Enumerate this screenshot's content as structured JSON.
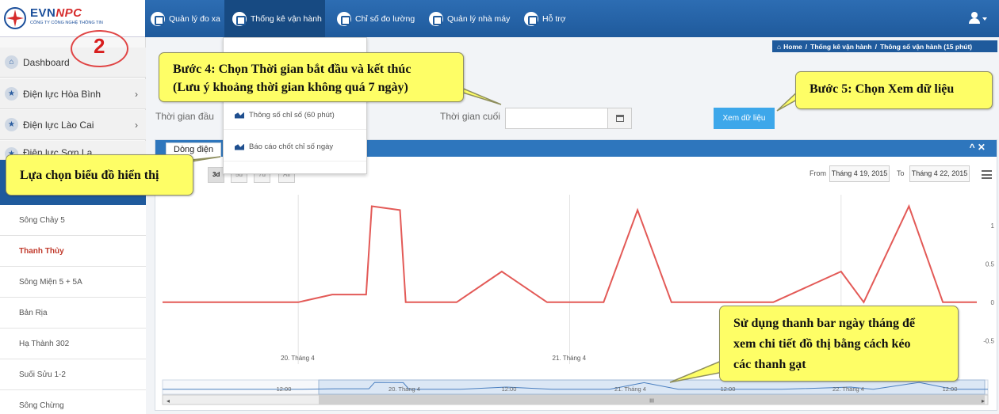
{
  "header": {
    "logo_name_a": "EVN",
    "logo_name_b": "NPC",
    "logo_subtitle": "CÔNG TY CÔNG NGHỆ THÔNG TIN",
    "nav": [
      {
        "label": "Quản lý đo xa",
        "icon": "wifi-icon"
      },
      {
        "label": "Thống kê vận hành",
        "icon": "chart-icon",
        "active": true
      },
      {
        "label": "Chỉ số đo lường",
        "icon": "edit-icon"
      },
      {
        "label": "Quản lý nhà máy",
        "icon": "folder-icon"
      },
      {
        "label": "Hỗ trợ",
        "icon": "folder-icon"
      }
    ],
    "user_icon": "user-icon"
  },
  "sidebar": {
    "main_items": [
      {
        "label": "Dashboard",
        "icon": "home-icon"
      },
      {
        "label": "Điện lực Hòa Bình",
        "icon": "star-icon"
      },
      {
        "label": "Điện lực Lào Cai",
        "icon": "star-icon"
      },
      {
        "label": "Điện lực Sơn La",
        "icon": "star-icon"
      }
    ],
    "sub_items": [
      {
        "label": "Sông Chảy 5"
      },
      {
        "label": "Thanh Thủy",
        "active": true
      },
      {
        "label": "Sông Miện 5 + 5A"
      },
      {
        "label": "Bản Rịa"
      },
      {
        "label": "Hạ Thành 302"
      },
      {
        "label": "Suối Sửu 1-2"
      },
      {
        "label": "Sông Chừng"
      }
    ]
  },
  "breadcrumb": {
    "home": "Home",
    "sep": "/",
    "items": [
      "Thống kê vận hành",
      "Thông số vận hành (15 phút)"
    ]
  },
  "dropdown": {
    "items": [
      "Thông số chỉ số (60 phút)",
      "Báo cáo chốt chỉ số ngày"
    ]
  },
  "filters": {
    "start_label": "Thời gian đầu",
    "end_label": "Thời gian cuối",
    "end_value": "",
    "view_button": "Xem dữ liệu"
  },
  "panel": {
    "tab": "Dòng điện",
    "controls": "^ ✕",
    "range_buttons": [
      "3d",
      "5d",
      "7d",
      "All"
    ],
    "active_range": "3d",
    "from_label": "From",
    "from_value": "Tháng 4 19, 2015",
    "to_label": "To",
    "to_value": "Tháng 4 22, 2015"
  },
  "chart_data": {
    "type": "line",
    "series": [
      {
        "color": "#e35a57",
        "x": [
          "19/4 12:00",
          "19/4 18:00",
          "20/4 00:00",
          "20/4 03:00",
          "20/4 06:00",
          "20/4 06:30",
          "20/4 09:00",
          "20/4 09:30",
          "20/4 14:00",
          "20/4 18:00",
          "20/4 22:00",
          "21/4 03:00",
          "21/4 06:00",
          "21/4 09:00",
          "21/4 12:00",
          "21/4 18:00",
          "22/4 00:00",
          "22/4 02:00",
          "22/4 06:00",
          "22/4 09:00",
          "22/4 12:00"
        ],
        "y": [
          0,
          0,
          0,
          0.1,
          0.1,
          1.25,
          1.2,
          0,
          0,
          0.4,
          0,
          0,
          1.2,
          0,
          0,
          0,
          0.4,
          0,
          1.25,
          0,
          0
        ]
      }
    ],
    "y_ticks": [
      "1",
      "0.5",
      "0",
      "-0.5"
    ],
    "ylim": [
      -0.6,
      1.4
    ],
    "x_tick_labels": [
      "20. Tháng 4",
      "21. Tháng 4"
    ],
    "navigator_labels": [
      "12:00",
      "20. Tháng 4",
      "12:00",
      "21. Tháng 4",
      "12:00",
      "22. Tháng 4",
      "12:00"
    ],
    "navigator_handle": "III",
    "grid": true
  },
  "annotations": {
    "step_number": "2",
    "step4_line1": "Bước 4: Chọn Thời gian bắt đầu và kết thúc",
    "step4_line2": "(Lưu ý khoảng thời gian không quá 7 ngày)",
    "step5": "Bước 5: Chọn Xem dữ liệu",
    "chart_select": "Lựa chọn biểu đồ hiển thị",
    "navigator_line1": "Sử dụng thanh bar ngày tháng để",
    "navigator_line2": "xem chi tiết đồ thị bằng cách kéo",
    "navigator_line3": "các thanh gạt"
  }
}
